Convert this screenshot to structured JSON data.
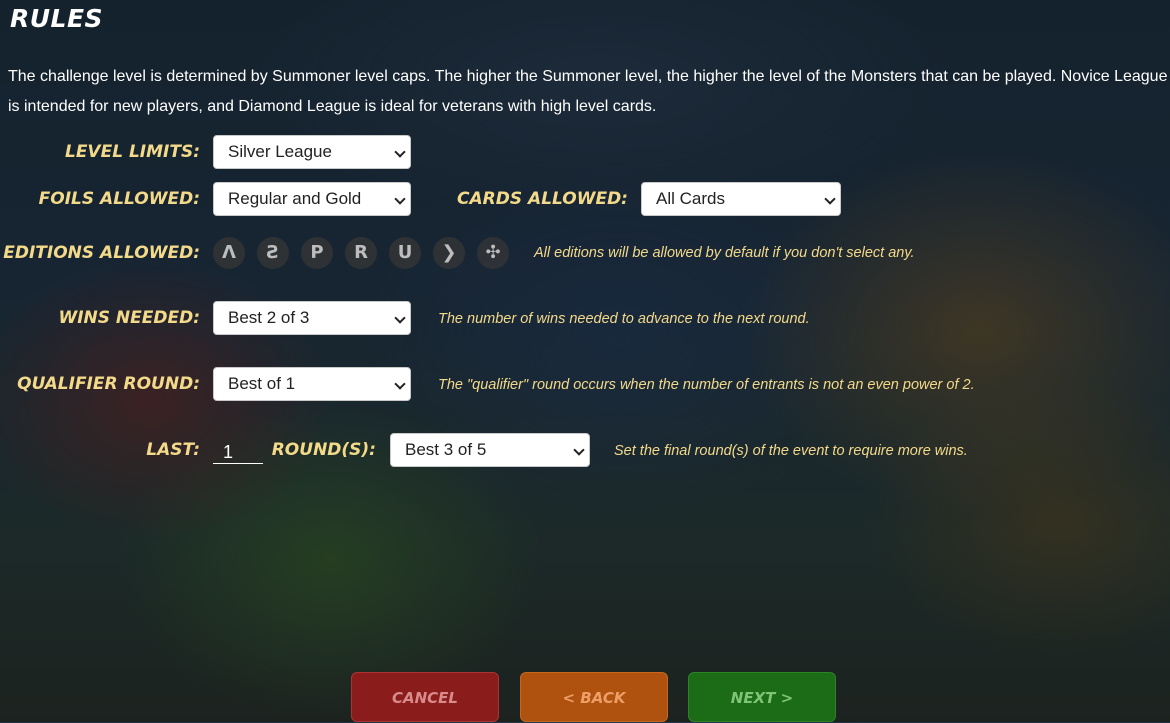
{
  "title": "RULES",
  "description": "The challenge level is determined by Summoner level caps. The higher the Summoner level, the higher the level of the Monsters that can be played. Novice League is intended for new players, and Diamond League is ideal for veterans with high level cards.",
  "level_limits": {
    "label": "LEVEL LIMITS:",
    "value": "Silver League"
  },
  "foils_allowed": {
    "label": "FOILS ALLOWED:",
    "value": "Regular and Gold"
  },
  "cards_allowed": {
    "label": "CARDS ALLOWED:",
    "value": "All Cards"
  },
  "editions_allowed": {
    "label": "EDITIONS ALLOWED:",
    "hint": "All editions will be allowed by default if you don't select any.",
    "items": [
      {
        "icon": "edition-alpha-icon",
        "glyph": "Λ"
      },
      {
        "icon": "edition-beta-icon",
        "glyph": "Ƨ"
      },
      {
        "icon": "edition-promo-icon",
        "glyph": "Ρ"
      },
      {
        "icon": "edition-reward-icon",
        "glyph": "R"
      },
      {
        "icon": "edition-untamed-icon",
        "glyph": "U"
      },
      {
        "icon": "edition-dice-icon",
        "glyph": "❯"
      },
      {
        "icon": "edition-chaos-icon",
        "glyph": "✣"
      }
    ]
  },
  "wins_needed": {
    "label": "WINS NEEDED:",
    "value": "Best 2 of 3",
    "hint": "The number of wins needed to advance to the next round."
  },
  "qualifier_round": {
    "label": "QUALIFIER ROUND:",
    "value": "Best of 1",
    "hint": "The \"qualifier\" round occurs when the number of entrants is not an even power of 2."
  },
  "last_rounds": {
    "last_label": "LAST:",
    "last_value": "1",
    "rounds_label": "ROUND(S):",
    "value": "Best 3 of 5",
    "hint": "Set the final round(s) of the event to require more wins."
  },
  "buttons": {
    "cancel": "CANCEL",
    "back": "< BACK",
    "next": "NEXT >"
  },
  "colors": {
    "label": "#f3d98a",
    "cancel": "#8a1c1c",
    "back": "#b0520f",
    "next": "#1b6b17"
  }
}
